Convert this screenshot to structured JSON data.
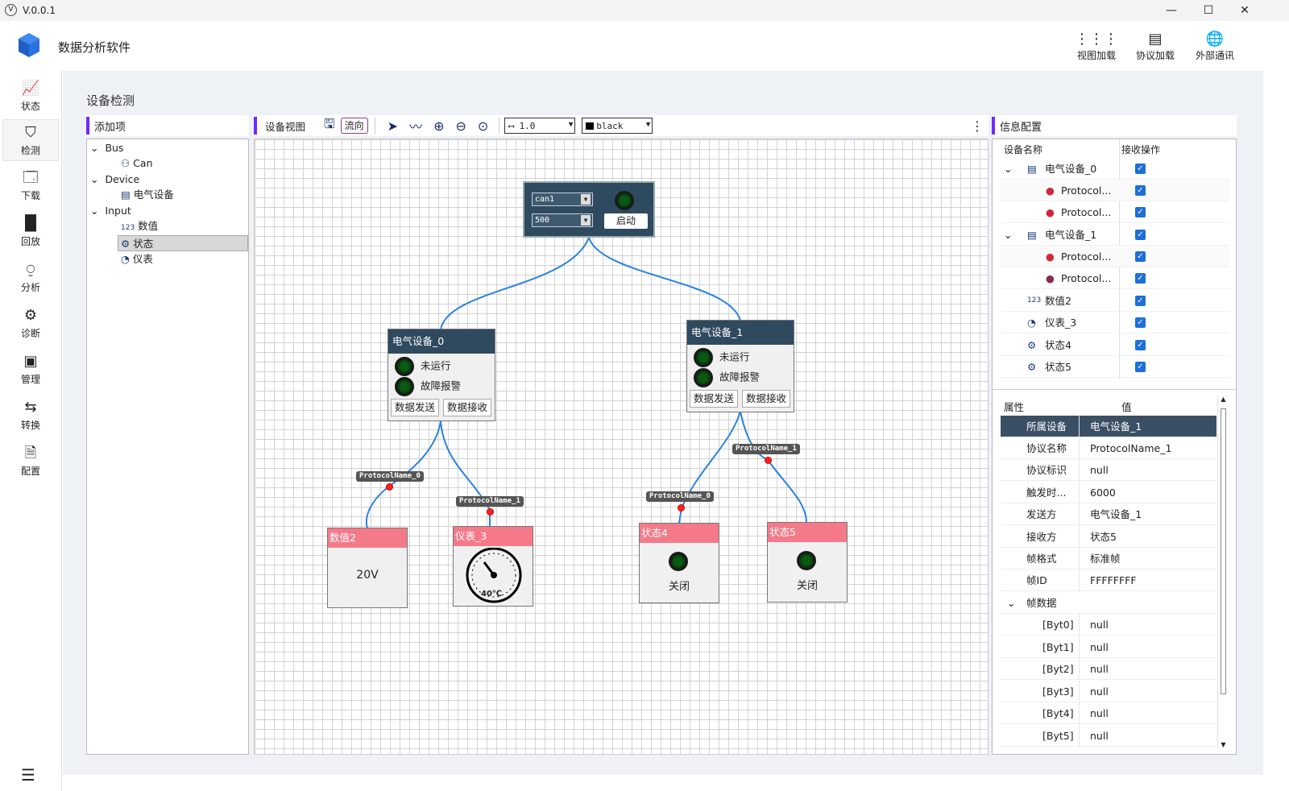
{
  "window": {
    "version": "V.0.0.1",
    "logo": "v-logo-icon"
  },
  "app": {
    "title": "数据分析软件"
  },
  "header_buttons": [
    {
      "label": "视图加载",
      "icon": "grid-icon"
    },
    {
      "label": "协议加载",
      "icon": "list-icon"
    },
    {
      "label": "外部通讯",
      "icon": "globe-icon"
    }
  ],
  "nav": [
    {
      "label": "状态",
      "icon": "chart-icon"
    },
    {
      "label": "检测",
      "icon": "shield-icon"
    },
    {
      "label": "下载",
      "icon": "ftp-icon"
    },
    {
      "label": "回放",
      "icon": "bar-chart-icon"
    },
    {
      "label": "分析",
      "icon": "pulse-icon"
    },
    {
      "label": "诊断",
      "icon": "gear-icon"
    },
    {
      "label": "管理",
      "icon": "calendar-icon"
    },
    {
      "label": "转换",
      "icon": "convert-icon"
    },
    {
      "label": "配置",
      "icon": "config-icon"
    }
  ],
  "page": {
    "title": "设备检测"
  },
  "left_panel": {
    "title": "添加项",
    "tree": [
      {
        "label": "Bus",
        "children": [
          {
            "label": "Can"
          }
        ]
      },
      {
        "label": "Device",
        "children": [
          {
            "label": "电气设备"
          }
        ]
      },
      {
        "label": "Input",
        "children": [
          {
            "label": "数值"
          },
          {
            "label": "状态"
          },
          {
            "label": "仪表"
          }
        ]
      }
    ]
  },
  "view_panel": {
    "title": "设备视图",
    "flow_label": "流向",
    "line_width": "1.0",
    "color": "black"
  },
  "canvas": {
    "controller": {
      "channel": "can1",
      "rate": "500",
      "start": "启动"
    },
    "devices": [
      {
        "name": "电气设备_0",
        "status1": "未运行",
        "status2": "故障报警",
        "send": "数据发送",
        "recv": "数据接收"
      },
      {
        "name": "电气设备_1",
        "status1": "未运行",
        "status2": "故障报警",
        "send": "数据发送",
        "recv": "数据接收"
      }
    ],
    "protocol_labels": [
      "ProtocolName_0",
      "ProtocolName_1",
      "ProtocolName_0",
      "ProtocolName_1"
    ],
    "inputs": [
      {
        "name": "数值2",
        "value": "20V"
      },
      {
        "name": "仪表_3",
        "value": "40℃"
      },
      {
        "name": "状态4",
        "value": "关闭"
      },
      {
        "name": "状态5",
        "value": "关闭"
      }
    ]
  },
  "info_panel": {
    "title": "信息配置",
    "col_name": "设备名称",
    "col_op": "接收操作",
    "rows": [
      "电气设备_0",
      "Protocol...",
      "Protocol...",
      "电气设备_1",
      "Protocol...",
      "Protocol...",
      "数值2",
      "仪表_3",
      "状态4",
      "状态5"
    ],
    "prop_col": "属性",
    "val_col": "值",
    "props": [
      {
        "k": "所属设备",
        "v": "电气设备_1"
      },
      {
        "k": "协议名称",
        "v": "ProtocolName_1"
      },
      {
        "k": "协议标识",
        "v": "null"
      },
      {
        "k": "触发时...",
        "v": "6000"
      },
      {
        "k": "发送方",
        "v": "电气设备_1"
      },
      {
        "k": "接收方",
        "v": "状态5"
      },
      {
        "k": "帧格式",
        "v": "标准帧"
      },
      {
        "k": "帧ID",
        "v": "FFFFFFFF"
      },
      {
        "k": "帧数据",
        "v": ""
      },
      {
        "k": "[Byt0]",
        "v": "null"
      },
      {
        "k": "[Byt1]",
        "v": "null"
      },
      {
        "k": "[Byt2]",
        "v": "null"
      },
      {
        "k": "[Byt3]",
        "v": "null"
      },
      {
        "k": "[Byt4]",
        "v": "null"
      },
      {
        "k": "[Byt5]",
        "v": "null"
      }
    ]
  }
}
